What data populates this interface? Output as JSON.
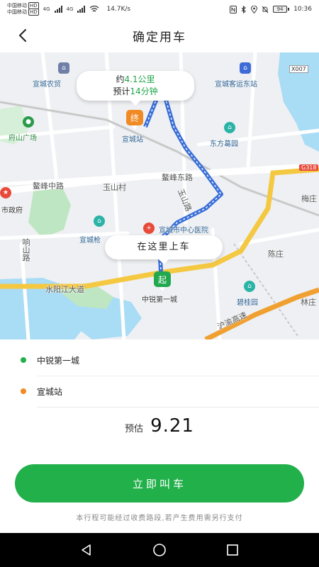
{
  "status_bar": {
    "carrier1": "中国移动",
    "carrier2": "中国移动",
    "hd1": "HD",
    "hd2": "HD",
    "net1": "4G",
    "net2": "4G",
    "speed": "14.7K/s",
    "battery": "94",
    "time": "10:36"
  },
  "header": {
    "title": "确定用车",
    "back_icon": "chevron-left-icon"
  },
  "map": {
    "route_bubble": {
      "distance_prefix": "约",
      "distance_value": "4.1公里",
      "time_prefix": "预计",
      "time_value": "14分钟",
      "time_suffix": ""
    },
    "pickup_bubble": "在这里上车",
    "end_marker": "终",
    "start_marker": "起",
    "labels": {
      "farm_trade": "宣城农贸",
      "bus_station": "宣城客运东站",
      "road_code": "X007",
      "fushan_square": "府山广场",
      "xuancheng_station": "宣城站",
      "dongfang_garden": "东方葛园",
      "aofeng_east_road": "鳌峰东路",
      "g318": "G318",
      "aofeng_middle_road": "鳌峰中路",
      "yushan_village": "玉山村",
      "yushan_road": "玉山路",
      "meizhuang": "梅庄",
      "city_gov": "市政府",
      "xuancheng_school": "宣城枪",
      "hospital": "宣城市中心医院",
      "xiangshan_road": "响山路",
      "chenzhuang": "陈庄",
      "shuiyang_avenue": "水阳江大道",
      "zhongrui_city": "中锐第一城",
      "biguiyuan": "碧桂园",
      "linzhuang": "林庄",
      "expressway": "沪渝高速"
    },
    "colors": {
      "route_color": "#3a6fd8",
      "end_color": "#f08a24",
      "start_color": "#22a94f",
      "water_color": "#a9dcf5",
      "park_color": "#bfe6c2",
      "highway_color": "#f5c842",
      "expressway_color": "#f0a030"
    }
  },
  "addresses": {
    "start": {
      "name": "中锐第一城",
      "color": "#22b04b"
    },
    "end": {
      "name": "宣城站",
      "color": "#f08a24"
    }
  },
  "estimate": {
    "label": "预估",
    "price": "9.21"
  },
  "call_button": {
    "label": "立即叫车",
    "color": "#22b04b"
  },
  "toll_note": "本行程可能经过收费路段,若产生费用需另行支付",
  "nav_bar": {
    "back_icon": "triangle-back-icon",
    "home_icon": "circle-home-icon",
    "recents_icon": "square-recents-icon"
  }
}
